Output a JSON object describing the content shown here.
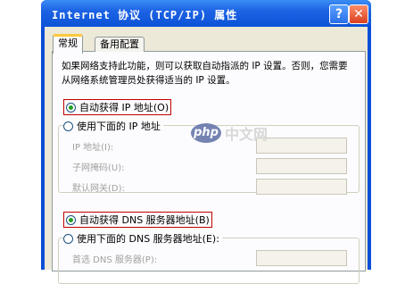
{
  "window": {
    "title": "Internet 协议 (TCP/IP) 属性",
    "help_label": "?",
    "close_label": "✕"
  },
  "tabs": [
    {
      "label": "常规",
      "selected": true
    },
    {
      "label": "备用配置",
      "selected": false
    }
  ],
  "intro": "如果网络支持此功能，则可以获取自动指派的 IP 设置。否则，您需要从网络系统管理员处获得适当的 IP 设置。",
  "ip": {
    "auto_label": "自动获得 IP 地址(O)",
    "auto_selected": true,
    "manual_label": "使用下面的 IP 地址",
    "fields": [
      {
        "label": "IP 地址(I):",
        "value": ""
      },
      {
        "label": "子网掩码(U):",
        "value": ""
      },
      {
        "label": "默认网关(D):",
        "value": ""
      }
    ]
  },
  "dns": {
    "auto_label": "自动获得 DNS 服务器地址(B)",
    "auto_selected": true,
    "manual_label": "使用下面的 DNS 服务器地址(E):",
    "fields": [
      {
        "label": "首选 DNS 服务器(P):",
        "value": ""
      }
    ]
  },
  "watermark": {
    "logo": "php",
    "text": "中文网"
  },
  "colors": {
    "titlebar": "#0b52d6",
    "highlight": "#c00000",
    "face": "#ece9d8"
  }
}
